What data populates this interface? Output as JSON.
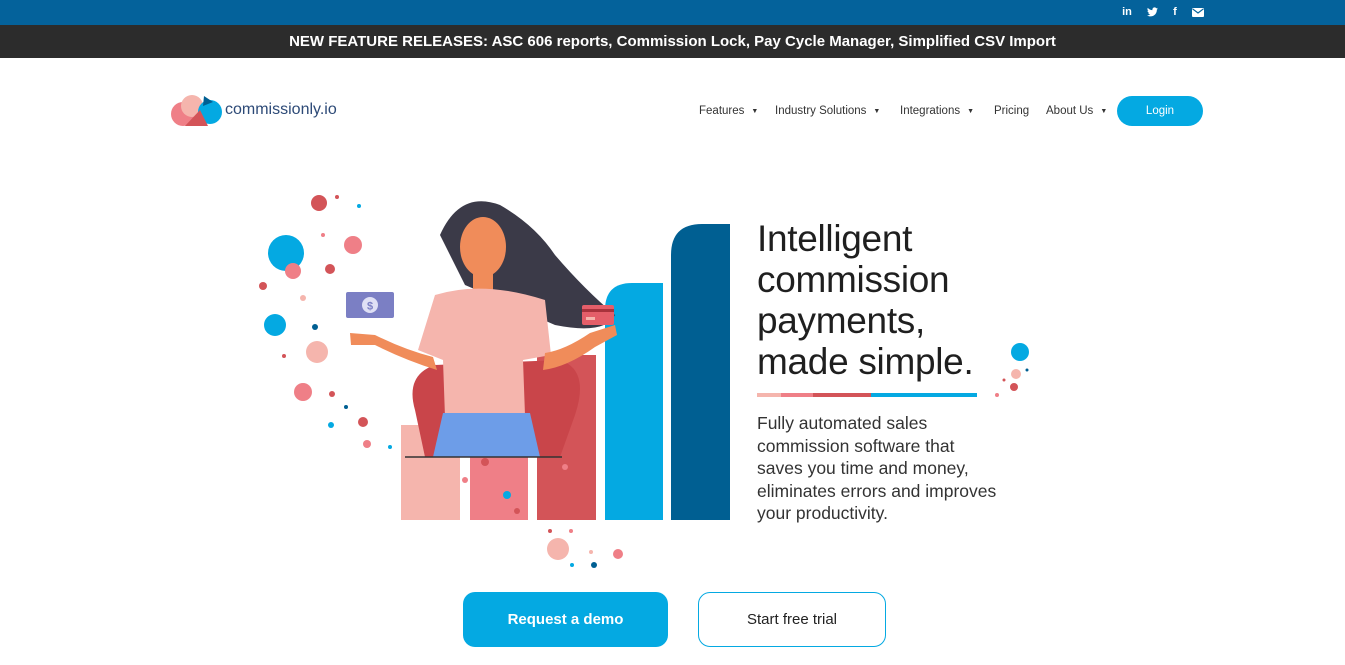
{
  "social": {
    "linkedin_icon": "linkedin-icon",
    "twitter_icon": "twitter-icon",
    "facebook_icon": "facebook-icon",
    "email_icon": "envelope-icon"
  },
  "banner": {
    "text": "NEW FEATURE RELEASES: ASC 606 reports, Commission Lock, Pay Cycle Manager, Simplified CSV Import"
  },
  "logo": {
    "text": "commissionly.io"
  },
  "nav": {
    "items": [
      {
        "label": "Features",
        "has_dropdown": true
      },
      {
        "label": "Industry Solutions",
        "has_dropdown": true
      },
      {
        "label": "Integrations",
        "has_dropdown": true
      },
      {
        "label": "Pricing",
        "has_dropdown": false
      },
      {
        "label": "About Us",
        "has_dropdown": true
      }
    ],
    "login_label": "Login"
  },
  "hero": {
    "headline": "Intelligent commission payments, made simple.",
    "subtext": "Fully automated sales commission software that saves you time and money, eliminates errors and improves your productivity.",
    "demo_label": "Request a demo",
    "trial_label": "Start free trial"
  },
  "colors": {
    "top_bar": "#04629b",
    "banner": "#2c2c2c",
    "accent_blue": "#04a9e2",
    "dark_blue": "#005f92",
    "coral": "#d35458",
    "pink": "#ef7f87",
    "peach": "#f5b5ad"
  }
}
